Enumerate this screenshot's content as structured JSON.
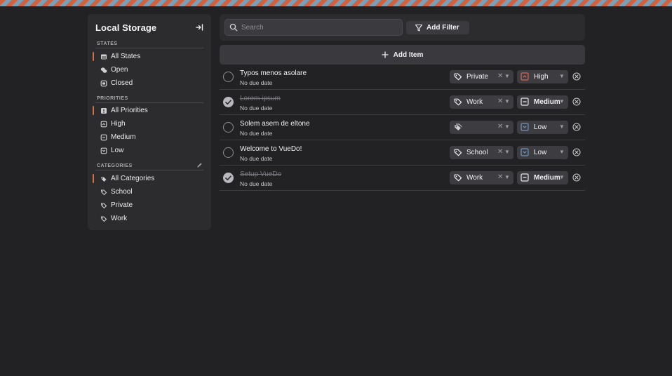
{
  "sidebar": {
    "title": "Local Storage",
    "sections": {
      "states": "STATES",
      "priorities": "PRIORITIES",
      "categories": "CATEGORIES"
    },
    "states": [
      {
        "label": "All States",
        "icon": "inbox-icon"
      },
      {
        "label": "Open",
        "icon": "chat-bubbles-icon"
      },
      {
        "label": "Closed",
        "icon": "archive-box-icon"
      }
    ],
    "priorities": [
      {
        "label": "All Priorities",
        "icon": "priority-all-icon"
      },
      {
        "label": "High",
        "icon": "priority-high-icon"
      },
      {
        "label": "Medium",
        "icon": "priority-medium-icon"
      },
      {
        "label": "Low",
        "icon": "priority-low-icon"
      }
    ],
    "categories": [
      {
        "label": "All Categories",
        "icon": "tags-icon"
      },
      {
        "label": "School",
        "icon": "tag-icon"
      },
      {
        "label": "Private",
        "icon": "tag-icon"
      },
      {
        "label": "Work",
        "icon": "tag-icon"
      }
    ]
  },
  "toolbar": {
    "search_placeholder": "Search",
    "search_value": "",
    "filter_label": "Add Filter",
    "add_item_label": "Add Item"
  },
  "todos": [
    {
      "title": "Typos menos asolare",
      "due": "No due date",
      "done": false,
      "category": "Private",
      "priority": "High"
    },
    {
      "title": "Lorem ipsum",
      "due": "No due date",
      "done": true,
      "category": "Work",
      "priority": "Medium"
    },
    {
      "title": "Solem asem de eltone",
      "due": "No due date",
      "done": false,
      "category": "",
      "priority": "Low"
    },
    {
      "title": "Welcome to VueDo!",
      "due": "No due date",
      "done": false,
      "category": "School",
      "priority": "Low"
    },
    {
      "title": "Setup VueDo",
      "due": "No due date",
      "done": true,
      "category": "Work",
      "priority": "Medium"
    }
  ],
  "colors": {
    "accent": "#d2704a",
    "high": "#d46a55",
    "low": "#6f95bd",
    "medium": "#e8e8ea"
  }
}
